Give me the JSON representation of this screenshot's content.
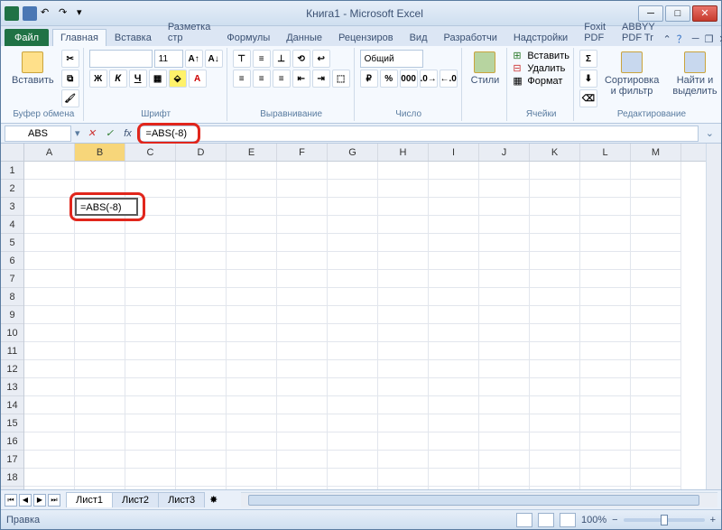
{
  "window": {
    "title": "Книга1 - Microsoft Excel"
  },
  "tabs": {
    "file": "Файл",
    "items": [
      "Главная",
      "Вставка",
      "Разметка стр",
      "Формулы",
      "Данные",
      "Рецензиров",
      "Вид",
      "Разработчи",
      "Надстройки",
      "Foxit PDF",
      "ABBYY PDF Tr"
    ],
    "active_index": 0
  },
  "ribbon": {
    "clipboard": {
      "paste": "Вставить",
      "label": "Буфер обмена"
    },
    "font": {
      "family": "",
      "size": "11",
      "label": "Шрифт"
    },
    "alignment": {
      "label": "Выравнивание"
    },
    "number": {
      "format": "Общий",
      "label": "Число"
    },
    "styles": {
      "btn": "Стили",
      "label": ""
    },
    "cells": {
      "insert": "Вставить",
      "delete": "Удалить",
      "format": "Формат",
      "label": "Ячейки"
    },
    "editing": {
      "sort": "Сортировка и фильтр",
      "find": "Найти и выделить",
      "label": "Редактирование"
    }
  },
  "formula_bar": {
    "name_box": "ABS",
    "formula": "=ABS(-8)"
  },
  "grid": {
    "columns": [
      "A",
      "B",
      "C",
      "D",
      "E",
      "F",
      "G",
      "H",
      "I",
      "J",
      "K",
      "L",
      "M"
    ],
    "rows": 20,
    "active_col_index": 1,
    "edit_cell": {
      "row": 3,
      "col": 1,
      "text": "=ABS(-8)"
    }
  },
  "sheets": {
    "tabs": [
      "Лист1",
      "Лист2",
      "Лист3"
    ],
    "active_index": 0
  },
  "status": {
    "mode": "Правка",
    "zoom": "100%"
  }
}
